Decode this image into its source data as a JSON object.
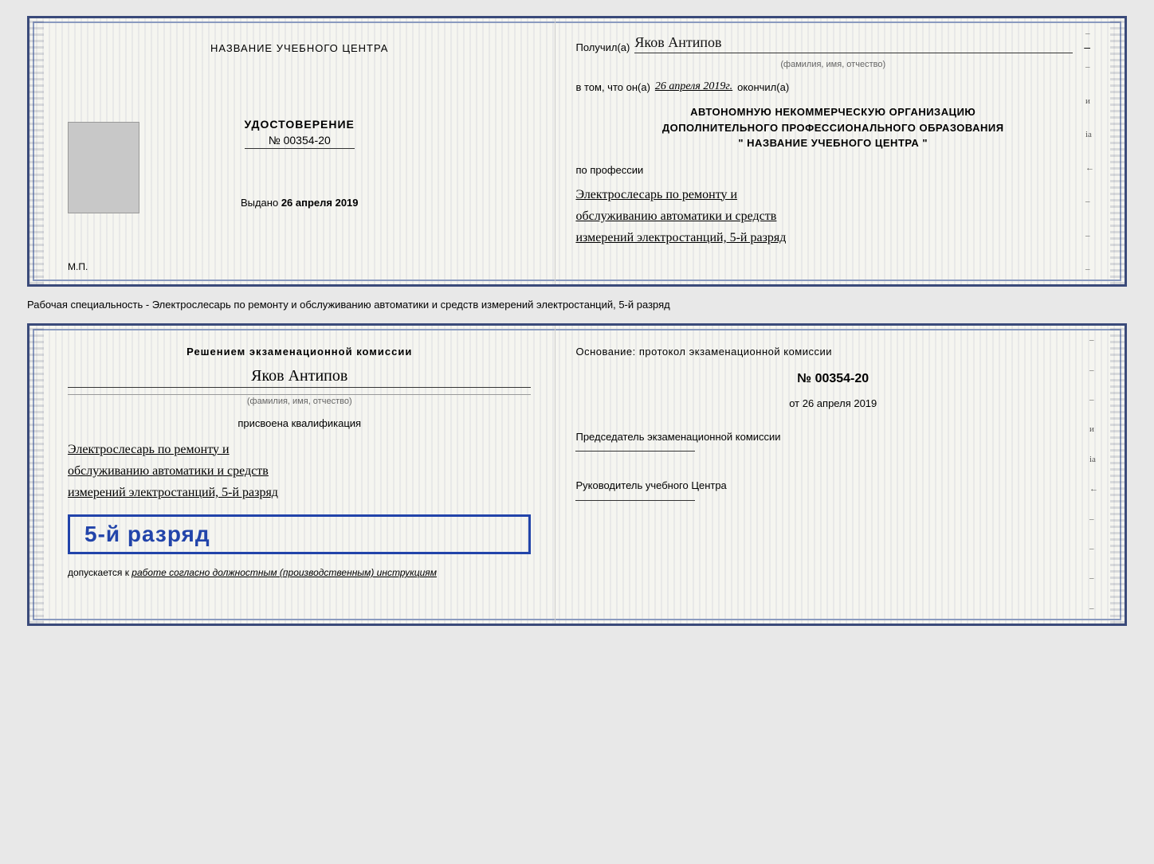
{
  "cert_top": {
    "left": {
      "title": "НАЗВАНИЕ УЧЕБНОГО ЦЕНТРА",
      "udost_label": "УДОСТОВЕРЕНИЕ",
      "number": "№ 00354-20",
      "issued_prefix": "Выдано",
      "issued_date": "26 апреля 2019",
      "mp": "М.П."
    },
    "right": {
      "poluchil": "Получил(а)",
      "name": "Яков Антипов",
      "name_sub": "(фамилия, имя, отчество)",
      "vtom_prefix": "в том, что он(а)",
      "vtom_date": "26 апреля 2019г.",
      "okonchil": "окончил(а)",
      "org_line1": "АВТОНОМНУЮ НЕКОММЕРЧЕСКУЮ ОРГАНИЗАЦИЮ",
      "org_line2": "ДОПОЛНИТЕЛЬНОГО ПРОФЕССИОНАЛЬНОГО ОБРАЗОВАНИЯ",
      "org_line3": "\"   НАЗВАНИЕ УЧЕБНОГО ЦЕНТРА   \"",
      "po_professii": "по профессии",
      "profession": "Электрослесарь по ремонту и обслуживанию автоматики и средств измерений электростанций, 5-й разряд"
    }
  },
  "middle": {
    "text": "Рабочая специальность - Электрослесарь по ремонту и обслуживанию автоматики и средств измерений электростанций, 5-й разряд"
  },
  "cert_bottom": {
    "left": {
      "resheniem": "Решением экзаменационной комиссии",
      "name": "Яков Антипов",
      "name_sub": "(фамилия, имя, отчество)",
      "prisvoyena": "присвоена квалификация",
      "qualification": "Электрослесарь по ремонту и обслуживанию автоматики и средств измерений электростанций, 5-й разряд",
      "badge_text": "5-й разряд",
      "dopuskaetsya_prefix": "допускается к",
      "dopuskaetsya_italic": "работе согласно должностным (производственным) инструкциям"
    },
    "right": {
      "osnovanie": "Основание: протокол экзаменационной комиссии",
      "number": "№  00354-20",
      "ot_prefix": "от",
      "ot_date": "26 апреля 2019",
      "predsedatel_label": "Председатель экзаменационной комиссии",
      "rukovoditel_label": "Руководитель учебного Центра"
    }
  }
}
